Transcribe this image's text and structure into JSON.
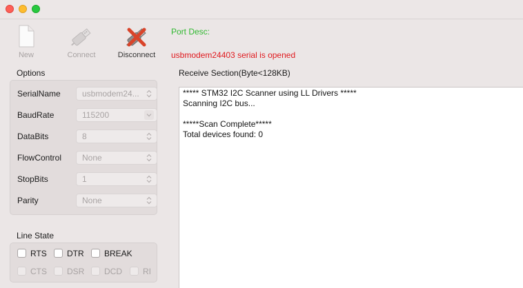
{
  "toolbar": {
    "new_label": "New",
    "connect_label": "Connect",
    "disconnect_label": "Disconnect"
  },
  "port_desc": "Port Desc:",
  "status_message": "usbmodem24403 serial is opened",
  "options": {
    "title": "Options",
    "fields": [
      {
        "label": "SerialName",
        "value": "usbmodem24..."
      },
      {
        "label": "BaudRate",
        "value": "115200"
      },
      {
        "label": "DataBits",
        "value": "8"
      },
      {
        "label": "FlowControl",
        "value": "None"
      },
      {
        "label": "StopBits",
        "value": "1"
      },
      {
        "label": "Parity",
        "value": "None"
      }
    ]
  },
  "line_state": {
    "title": "Line State",
    "outputs": [
      {
        "label": "RTS",
        "checked": false
      },
      {
        "label": "DTR",
        "checked": false
      },
      {
        "label": "BREAK",
        "checked": false
      }
    ],
    "inputs": [
      {
        "label": "CTS",
        "checked": false
      },
      {
        "label": "DSR",
        "checked": false
      },
      {
        "label": "DCD",
        "checked": false
      },
      {
        "label": "RI",
        "checked": false
      }
    ]
  },
  "receive": {
    "title": "Receive Section(Byte<128KB)",
    "lines": [
      "***** STM32 I2C Scanner using LL Drivers *****",
      "Scanning I2C bus...",
      "",
      "*****Scan Complete*****",
      "Total devices found: 0"
    ]
  },
  "colors": {
    "port_desc": "#2fb82f",
    "status_message": "#e0191e",
    "disconnect_icon": "#d9442a"
  },
  "icons": {
    "new": "document-icon",
    "connect": "usb-plug-icon",
    "disconnect": "usb-plug-x-icon"
  }
}
